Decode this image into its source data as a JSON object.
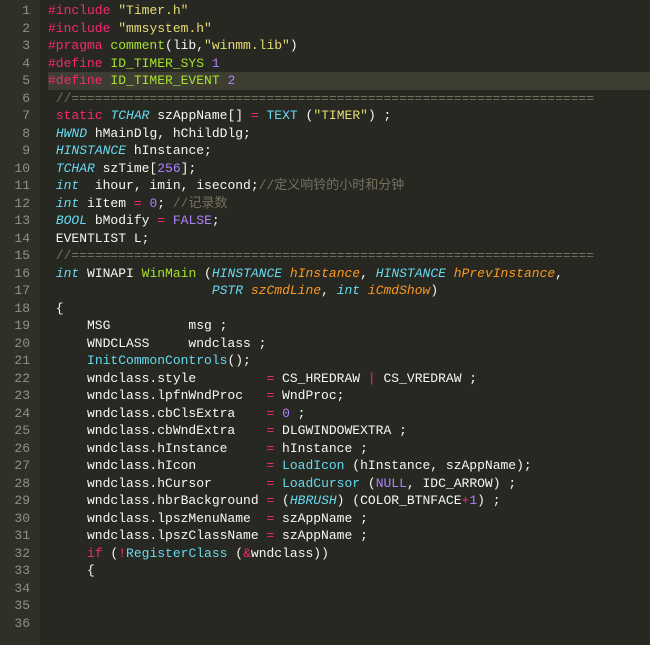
{
  "lines": [
    {
      "n": 1,
      "segs": [
        {
          "t": "#include",
          "c": "kw"
        },
        {
          "t": " "
        },
        {
          "t": "\"Timer.h\"",
          "c": "str"
        }
      ]
    },
    {
      "n": 2,
      "segs": [
        {
          "t": "#include",
          "c": "kw"
        },
        {
          "t": " "
        },
        {
          "t": "\"mmsystem.h\"",
          "c": "str"
        }
      ]
    },
    {
      "n": 3,
      "segs": [
        {
          "t": "#pragma",
          "c": "kw"
        },
        {
          "t": " "
        },
        {
          "t": "comment",
          "c": "fn"
        },
        {
          "t": "(lib,"
        },
        {
          "t": "\"winmm.lib\"",
          "c": "str"
        },
        {
          "t": ")"
        }
      ]
    },
    {
      "n": 4,
      "segs": [
        {
          "t": "#define",
          "c": "kw"
        },
        {
          "t": " "
        },
        {
          "t": "ID_TIMER_SYS",
          "c": "fn"
        },
        {
          "t": " "
        },
        {
          "t": "1",
          "c": "num"
        }
      ]
    },
    {
      "n": 5,
      "hl": true,
      "segs": [
        {
          "t": "#define",
          "c": "kw"
        },
        {
          "t": " "
        },
        {
          "t": "ID_TIMER_EVENT",
          "c": "fn"
        },
        {
          "t": " "
        },
        {
          "t": "2",
          "c": "num"
        }
      ]
    },
    {
      "n": 6,
      "segs": [
        {
          "t": " "
        },
        {
          "t": "//===================================================================",
          "c": "cmt"
        }
      ]
    },
    {
      "n": 7,
      "segs": [
        {
          "t": " "
        },
        {
          "t": "static",
          "c": "kw"
        },
        {
          "t": " "
        },
        {
          "t": "TCHAR",
          "c": "type"
        },
        {
          "t": " szAppName[] "
        },
        {
          "t": "=",
          "c": "op"
        },
        {
          "t": " "
        },
        {
          "t": "TEXT",
          "c": "fnc"
        },
        {
          "t": " ("
        },
        {
          "t": "\"TIMER\"",
          "c": "str"
        },
        {
          "t": ") ;"
        }
      ]
    },
    {
      "n": 8,
      "segs": [
        {
          "t": " "
        },
        {
          "t": "HWND",
          "c": "type"
        },
        {
          "t": " hMainDlg, hChildDlg;"
        }
      ]
    },
    {
      "n": 9,
      "segs": [
        {
          "t": " "
        },
        {
          "t": "HINSTANCE",
          "c": "type"
        },
        {
          "t": " hInstance;"
        }
      ]
    },
    {
      "n": 10,
      "segs": [
        {
          "t": " "
        },
        {
          "t": "TCHAR",
          "c": "type"
        },
        {
          "t": " szTime["
        },
        {
          "t": "256",
          "c": "num"
        },
        {
          "t": "];"
        }
      ]
    },
    {
      "n": 11,
      "segs": [
        {
          "t": " "
        },
        {
          "t": "int",
          "c": "type"
        },
        {
          "t": "  ihour, imin, isecond;"
        },
        {
          "t": "//定义响铃的小时和分钟",
          "c": "cmt"
        }
      ]
    },
    {
      "n": 12,
      "segs": [
        {
          "t": " "
        },
        {
          "t": "int",
          "c": "type"
        },
        {
          "t": " iItem "
        },
        {
          "t": "=",
          "c": "op"
        },
        {
          "t": " "
        },
        {
          "t": "0",
          "c": "num"
        },
        {
          "t": "; "
        },
        {
          "t": "//记录数",
          "c": "cmt"
        }
      ]
    },
    {
      "n": 13,
      "segs": [
        {
          "t": " "
        },
        {
          "t": "BOOL",
          "c": "type"
        },
        {
          "t": " bModify "
        },
        {
          "t": "=",
          "c": "op"
        },
        {
          "t": " "
        },
        {
          "t": "FALSE",
          "c": "num"
        },
        {
          "t": ";"
        }
      ]
    },
    {
      "n": 14,
      "segs": [
        {
          "t": " EVENTLIST L;"
        }
      ]
    },
    {
      "n": 15,
      "segs": [
        {
          "t": " "
        },
        {
          "t": "//===================================================================",
          "c": "cmt"
        }
      ]
    },
    {
      "n": 16,
      "segs": [
        {
          "t": " "
        },
        {
          "t": "int",
          "c": "type"
        },
        {
          "t": " WINAPI "
        },
        {
          "t": "WinMain",
          "c": "fn"
        },
        {
          "t": " ("
        },
        {
          "t": "HINSTANCE",
          "c": "type"
        },
        {
          "t": " "
        },
        {
          "t": "hInstance",
          "c": "param"
        },
        {
          "t": ", "
        },
        {
          "t": "HINSTANCE",
          "c": "type"
        },
        {
          "t": " "
        },
        {
          "t": "hPrevInstance",
          "c": "param"
        },
        {
          "t": ","
        }
      ]
    },
    {
      "n": 17,
      "segs": [
        {
          "t": "                     "
        },
        {
          "t": "PSTR",
          "c": "type"
        },
        {
          "t": " "
        },
        {
          "t": "szCmdLine",
          "c": "param"
        },
        {
          "t": ", "
        },
        {
          "t": "int",
          "c": "type"
        },
        {
          "t": " "
        },
        {
          "t": "iCmdShow",
          "c": "param"
        },
        {
          "t": ")"
        }
      ]
    },
    {
      "n": 18,
      "segs": [
        {
          "t": " {"
        }
      ]
    },
    {
      "n": 19,
      "segs": [
        {
          "t": "     MSG          msg ;"
        }
      ]
    },
    {
      "n": 20,
      "segs": [
        {
          "t": "     WNDCLASS     wndclass ;"
        }
      ]
    },
    {
      "n": 21,
      "segs": [
        {
          "t": ""
        }
      ]
    },
    {
      "n": 22,
      "segs": [
        {
          "t": "     "
        },
        {
          "t": "InitCommonControls",
          "c": "fnc"
        },
        {
          "t": "();"
        }
      ]
    },
    {
      "n": 23,
      "segs": [
        {
          "t": ""
        }
      ]
    },
    {
      "n": 24,
      "segs": [
        {
          "t": "     wndclass.style         "
        },
        {
          "t": "=",
          "c": "op"
        },
        {
          "t": " CS_HREDRAW "
        },
        {
          "t": "|",
          "c": "op"
        },
        {
          "t": " CS_VREDRAW ;"
        }
      ]
    },
    {
      "n": 25,
      "segs": [
        {
          "t": "     wndclass.lpfnWndProc   "
        },
        {
          "t": "=",
          "c": "op"
        },
        {
          "t": " WndProc;"
        }
      ]
    },
    {
      "n": 26,
      "segs": [
        {
          "t": "     wndclass.cbClsExtra    "
        },
        {
          "t": "=",
          "c": "op"
        },
        {
          "t": " "
        },
        {
          "t": "0",
          "c": "num"
        },
        {
          "t": " ;"
        }
      ]
    },
    {
      "n": 27,
      "segs": [
        {
          "t": "     wndclass.cbWndExtra    "
        },
        {
          "t": "=",
          "c": "op"
        },
        {
          "t": " DLGWINDOWEXTRA ;"
        }
      ]
    },
    {
      "n": 28,
      "segs": [
        {
          "t": "     wndclass.hInstance     "
        },
        {
          "t": "=",
          "c": "op"
        },
        {
          "t": " hInstance ;"
        }
      ]
    },
    {
      "n": 29,
      "segs": [
        {
          "t": "     wndclass.hIcon         "
        },
        {
          "t": "=",
          "c": "op"
        },
        {
          "t": " "
        },
        {
          "t": "LoadIcon",
          "c": "fnc"
        },
        {
          "t": " (hInstance, szAppName);"
        }
      ]
    },
    {
      "n": 30,
      "segs": [
        {
          "t": "     wndclass.hCursor       "
        },
        {
          "t": "=",
          "c": "op"
        },
        {
          "t": " "
        },
        {
          "t": "LoadCursor",
          "c": "fnc"
        },
        {
          "t": " ("
        },
        {
          "t": "NULL",
          "c": "num"
        },
        {
          "t": ", IDC_ARROW) ;"
        }
      ]
    },
    {
      "n": 31,
      "segs": [
        {
          "t": "     wndclass.hbrBackground "
        },
        {
          "t": "=",
          "c": "op"
        },
        {
          "t": " ("
        },
        {
          "t": "HBRUSH",
          "c": "type"
        },
        {
          "t": ") (COLOR_BTNFACE"
        },
        {
          "t": "+",
          "c": "op"
        },
        {
          "t": "1",
          "c": "num"
        },
        {
          "t": ") ;"
        }
      ]
    },
    {
      "n": 32,
      "segs": [
        {
          "t": "     wndclass.lpszMenuName  "
        },
        {
          "t": "=",
          "c": "op"
        },
        {
          "t": " szAppName ;"
        }
      ]
    },
    {
      "n": 33,
      "segs": [
        {
          "t": "     wndclass.lpszClassName "
        },
        {
          "t": "=",
          "c": "op"
        },
        {
          "t": " szAppName ;"
        }
      ]
    },
    {
      "n": 34,
      "segs": [
        {
          "t": ""
        }
      ]
    },
    {
      "n": 35,
      "segs": [
        {
          "t": "     "
        },
        {
          "t": "if",
          "c": "kw"
        },
        {
          "t": " ("
        },
        {
          "t": "!",
          "c": "op"
        },
        {
          "t": "RegisterClass",
          "c": "fnc"
        },
        {
          "t": " ("
        },
        {
          "t": "&",
          "c": "op"
        },
        {
          "t": "wndclass))"
        }
      ]
    },
    {
      "n": 36,
      "segs": [
        {
          "t": "     {"
        }
      ]
    }
  ]
}
